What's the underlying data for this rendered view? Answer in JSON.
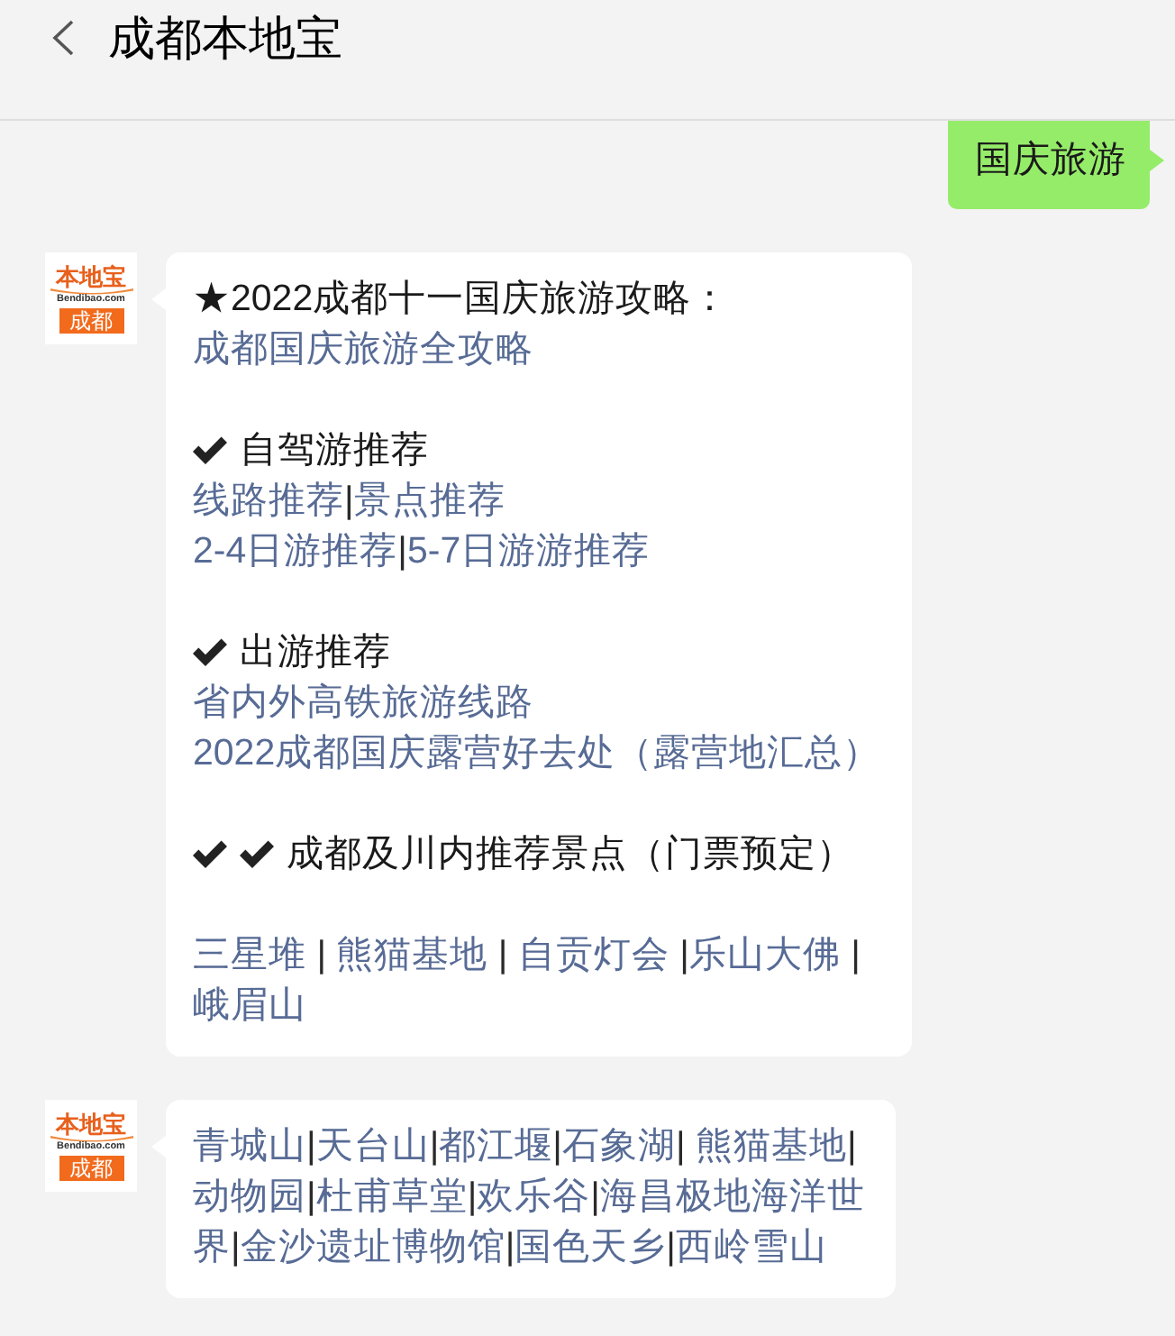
{
  "header": {
    "title": "成都本地宝"
  },
  "messages": [
    {
      "kind": "outgoing",
      "text": "国庆旅游"
    },
    {
      "kind": "incoming",
      "avatar": {
        "brand": "本地宝",
        "site": "Bendibao.com",
        "city": "成都"
      },
      "blocks": [
        {
          "lines": [
            [
              {
                "kind": "text",
                "text": "★2022成都十一国庆旅游攻略："
              }
            ],
            [
              {
                "kind": "link",
                "text": "成都国庆旅游全攻略"
              }
            ]
          ]
        },
        {
          "lines": [
            [
              {
                "kind": "check"
              },
              {
                "kind": "text",
                "text": "自驾游推荐"
              }
            ],
            [
              {
                "kind": "link",
                "text": "线路推荐"
              },
              {
                "kind": "separator",
                "text": "|"
              },
              {
                "kind": "link",
                "text": "景点推荐"
              }
            ],
            [
              {
                "kind": "link",
                "text": "2-4日游推荐"
              },
              {
                "kind": "separator",
                "text": "|"
              },
              {
                "kind": "link",
                "text": "5-7日游游推荐"
              }
            ]
          ]
        },
        {
          "lines": [
            [
              {
                "kind": "check"
              },
              {
                "kind": "text",
                "text": "出游推荐"
              }
            ],
            [
              {
                "kind": "link",
                "text": "省内外高铁旅游线路"
              }
            ],
            [
              {
                "kind": "link",
                "text": "2022成都国庆露营好去处（露营地汇总）"
              }
            ]
          ]
        },
        {
          "lines": [
            [
              {
                "kind": "check"
              },
              {
                "kind": "check"
              },
              {
                "kind": "text",
                "text": "成都及川内推荐景点（门票预定）"
              }
            ]
          ]
        },
        {
          "lines": [
            [
              {
                "kind": "link",
                "text": "三星堆"
              },
              {
                "kind": "separator",
                "text": " | "
              },
              {
                "kind": "link",
                "text": "熊猫基地"
              },
              {
                "kind": "separator",
                "text": " | "
              },
              {
                "kind": "link",
                "text": "自贡灯会"
              },
              {
                "kind": "separator",
                "text": " |"
              },
              {
                "kind": "link",
                "text": "乐山大佛"
              },
              {
                "kind": "separator",
                "text": " |"
              }
            ],
            [
              {
                "kind": "link",
                "text": "峨眉山"
              }
            ]
          ]
        }
      ]
    },
    {
      "kind": "incoming",
      "avatar": {
        "brand": "本地宝",
        "site": "Bendibao.com",
        "city": "成都"
      },
      "blocks": [
        {
          "lines": [
            [
              {
                "kind": "link",
                "text": "青城山"
              },
              {
                "kind": "separator",
                "text": "|"
              },
              {
                "kind": "link",
                "text": "天台山"
              },
              {
                "kind": "separator",
                "text": "|"
              },
              {
                "kind": "link",
                "text": "都江堰"
              },
              {
                "kind": "separator",
                "text": "|"
              },
              {
                "kind": "link",
                "text": "石象湖"
              },
              {
                "kind": "separator",
                "text": "| "
              },
              {
                "kind": "link",
                "text": "熊猫基地"
              },
              {
                "kind": "separator",
                "text": "|"
              }
            ],
            [
              {
                "kind": "link",
                "text": "动物园"
              },
              {
                "kind": "separator",
                "text": "|"
              },
              {
                "kind": "link",
                "text": "杜甫草堂"
              },
              {
                "kind": "separator",
                "text": "|"
              },
              {
                "kind": "link",
                "text": "欢乐谷"
              },
              {
                "kind": "separator",
                "text": "|"
              },
              {
                "kind": "link",
                "text": "海昌极地海洋世"
              }
            ],
            [
              {
                "kind": "link",
                "text": "界"
              },
              {
                "kind": "separator",
                "text": "|"
              },
              {
                "kind": "link",
                "text": "金沙遗址博物馆"
              },
              {
                "kind": "separator",
                "text": "|"
              },
              {
                "kind": "link",
                "text": "国色天乡"
              },
              {
                "kind": "separator",
                "text": "|"
              },
              {
                "kind": "link",
                "text": "西岭雪山"
              }
            ]
          ]
        }
      ]
    }
  ]
}
